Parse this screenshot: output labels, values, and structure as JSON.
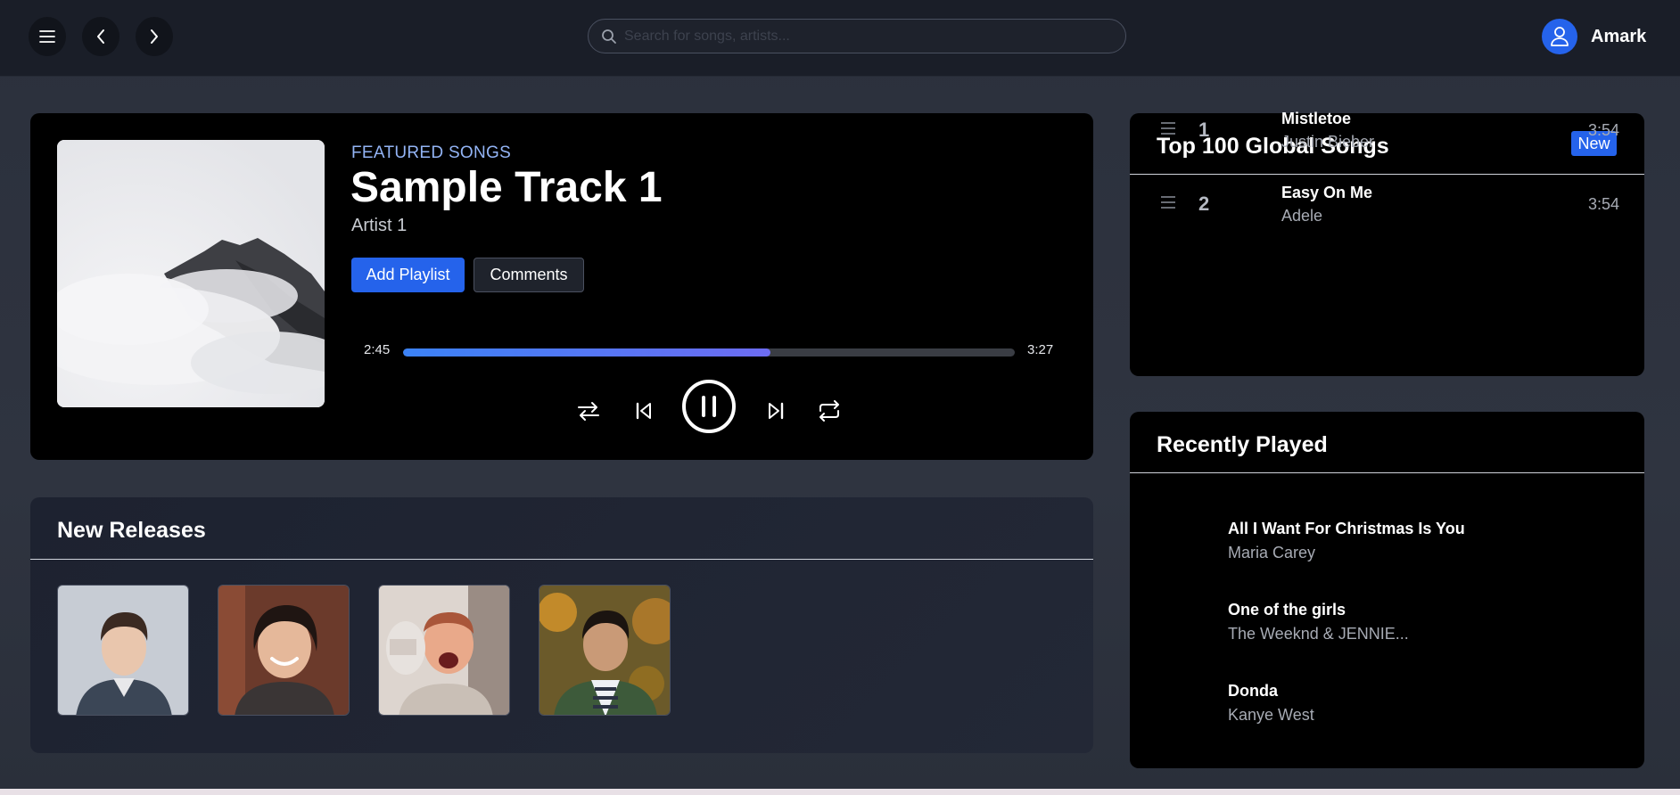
{
  "search": {
    "placeholder": "Search for songs, artists..."
  },
  "user": {
    "name": "Amark"
  },
  "featured": {
    "label": "FEATURED SONGS",
    "title": "Sample Track 1",
    "artist": "Artist 1",
    "add_playlist_label": "Add Playlist",
    "comments_label": "Comments",
    "current_time": "2:45",
    "total_time": "3:27",
    "progress": 0.6
  },
  "new_releases": {
    "title": "New Releases"
  },
  "top_songs": {
    "title": "Top 100 Global Songs",
    "badge": "New",
    "items": [
      {
        "rank": "1",
        "title": "Mistletoe",
        "artist": "Justin Bieber",
        "duration": "3:54"
      },
      {
        "rank": "2",
        "title": "Easy On Me",
        "artist": "Adele",
        "duration": "3:54"
      }
    ]
  },
  "recently_played": {
    "title": "Recently Played",
    "items": [
      {
        "title": "All I Want For Christmas Is You",
        "artist": "Maria Carey"
      },
      {
        "title": "One of the girls",
        "artist": "The Weeknd & JENNIE..."
      },
      {
        "title": "Donda",
        "artist": "Kanye West"
      }
    ]
  },
  "colors": {
    "accent": "#2563eb",
    "progress_end": "#6d6cf2",
    "label": "#93b4f5"
  },
  "icons": [
    "menu-icon",
    "chevron-left-icon",
    "chevron-right-icon",
    "search-icon",
    "user-icon",
    "shuffle-icon",
    "previous-icon",
    "pause-icon",
    "next-icon",
    "repeat-icon",
    "drag-handle-icon"
  ]
}
